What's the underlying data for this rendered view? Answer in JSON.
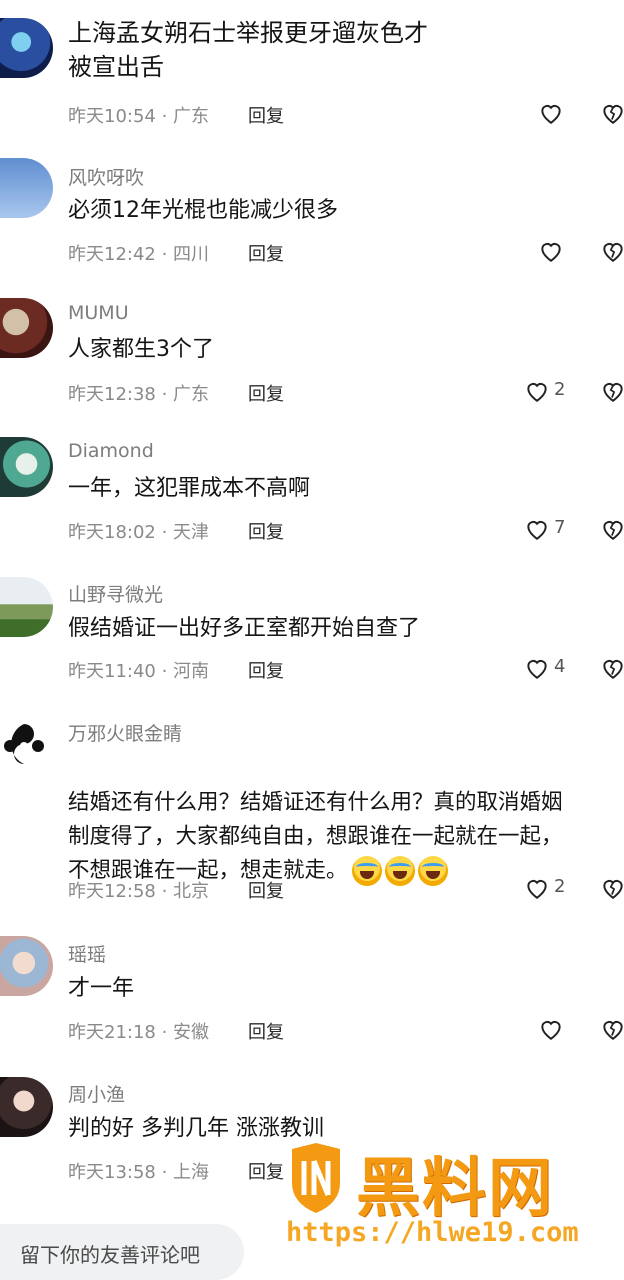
{
  "comments": [
    {
      "username": "",
      "content": "上海孟女朔石士举报更牙遛灰色才\n被宣出舌",
      "time": "昨天10:54",
      "location": "广东",
      "reply": "回复",
      "likes": "",
      "avatar_color": "#1b2f6a",
      "avatar_icon": "balloon-avatar"
    },
    {
      "username": "风吹呀吹",
      "content": "必须12年光棍也能减少很多",
      "time": "昨天12:42",
      "location": "四川",
      "reply": "回复",
      "likes": "",
      "avatar_color": "#7aa0d8",
      "avatar_icon": "sky-avatar"
    },
    {
      "username": "MUMU",
      "content": "人家都生3个了",
      "time": "昨天12:38",
      "location": "广东",
      "reply": "回复",
      "likes": "2",
      "avatar_color": "#6b2a22",
      "avatar_icon": "person-avatar"
    },
    {
      "username": "Diamond",
      "content": "一年，这犯罪成本不高啊",
      "time": "昨天18:02",
      "location": "天津",
      "reply": "回复",
      "likes": "7",
      "avatar_color": "#4fa892",
      "avatar_icon": "anime-avatar"
    },
    {
      "username": "山野寻微光",
      "content": "假结婚证一出好多正室都开始自查了",
      "time": "昨天11:40",
      "location": "河南",
      "reply": "回复",
      "likes": "4",
      "avatar_color": "#5e8f3a",
      "avatar_icon": "landscape-avatar"
    },
    {
      "username": "万邪火眼金睛",
      "content": "结婚还有什么用？结婚证还有什么用？真的取消婚姻\n制度得了，大家都纯自由，想跟谁在一起就在一起，\n不想跟谁在一起，想走就走。",
      "time": "昨天12:58",
      "location": "北京",
      "reply": "回复",
      "likes": "2",
      "avatar_color": "#111111",
      "avatar_icon": "swirl-avatar",
      "emojis": 3
    },
    {
      "username": "瑶瑶",
      "content": "才一年",
      "time": "昨天21:18",
      "location": "安徽",
      "reply": "回复",
      "likes": "",
      "avatar_color": "#c9a6a0",
      "avatar_icon": "girl-avatar"
    },
    {
      "username": "周小渔",
      "content": "判的好 多判几年 涨涨教训",
      "time": "昨天13:58",
      "location": "上海",
      "reply": "回复",
      "likes": "",
      "avatar_color": "#3a2a2a",
      "avatar_icon": "woman-avatar"
    }
  ],
  "input": {
    "placeholder": "留下你的友善评论吧"
  },
  "watermark": {
    "title": "黑料网",
    "url": "https://hlwe19.com"
  },
  "colors": {
    "text": "#151515",
    "meta": "#8a8a8a",
    "username": "#7d7d7d",
    "watermark": "#f39a12"
  }
}
